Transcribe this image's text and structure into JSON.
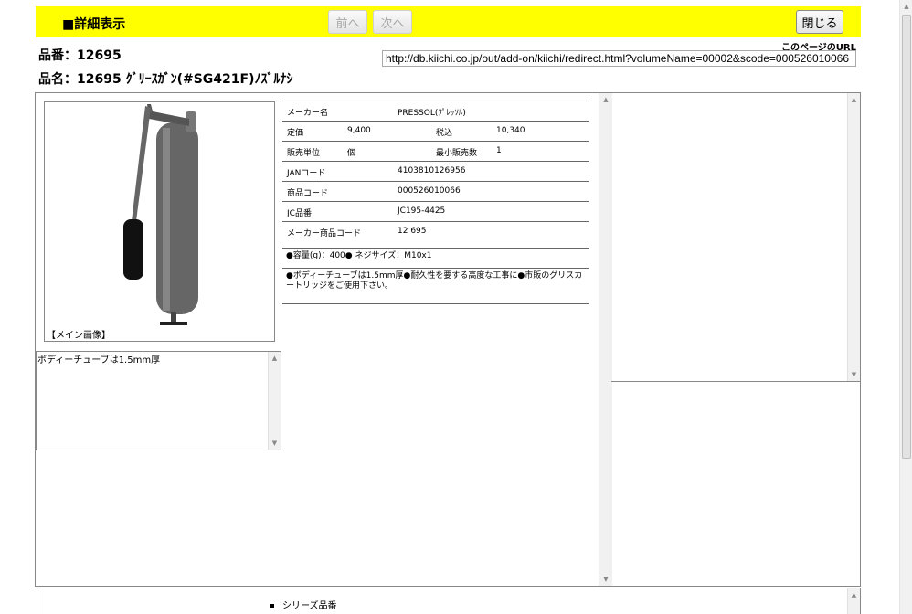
{
  "header": {
    "title": "■詳細表示",
    "prev_label": "前へ",
    "next_label": "次へ",
    "close_label": "閉じる"
  },
  "product": {
    "number": "品番：12695",
    "name": "品名：12695 ｸﾞﾘｰｽｶﾞﾝ(#SG421F)ﾉｽﾞﾙﾅｼ"
  },
  "url": {
    "label": "このページのURL",
    "value": "http://db.kiichi.co.jp/out/add-on/kiichi/redirect.html?volumeName=00002&scode=000526010066"
  },
  "image": {
    "caption": "【メイン画像】"
  },
  "description": "ボディーチューブは1.5mm厚",
  "spec": {
    "maker_label": "メーカー名",
    "maker_value": "PRESSOL(ﾌﾟﾚｯｿﾙ)",
    "price_label": "定価",
    "price_value": "9,400",
    "tax_label": "税込",
    "tax_value": "10,340",
    "unit_label": "販売単位",
    "unit_value": "個",
    "min_label": "最小販売数",
    "min_value": "1",
    "jan_label": "JANコード",
    "jan_value": "4103810126956",
    "code_label": "商品コード",
    "code_value": "000526010066",
    "jc_label": "JC品番",
    "jc_value": "JC195-4425",
    "maker_code_label": "メーカー商品コード",
    "maker_code_value": "12 695",
    "note1": "●容量(g)：400● ネジサイズ：M10x1",
    "note2": "●ボディーチューブは1.5mm厚●耐久性を要する高度な工事に●市販のグリスカートリッジをご使用下さい。"
  },
  "series_label": "シリーズ品番",
  "colors": {
    "header_bg": "#ffff00",
    "gun_body": "#6a6a6a",
    "grip": "#111111"
  }
}
